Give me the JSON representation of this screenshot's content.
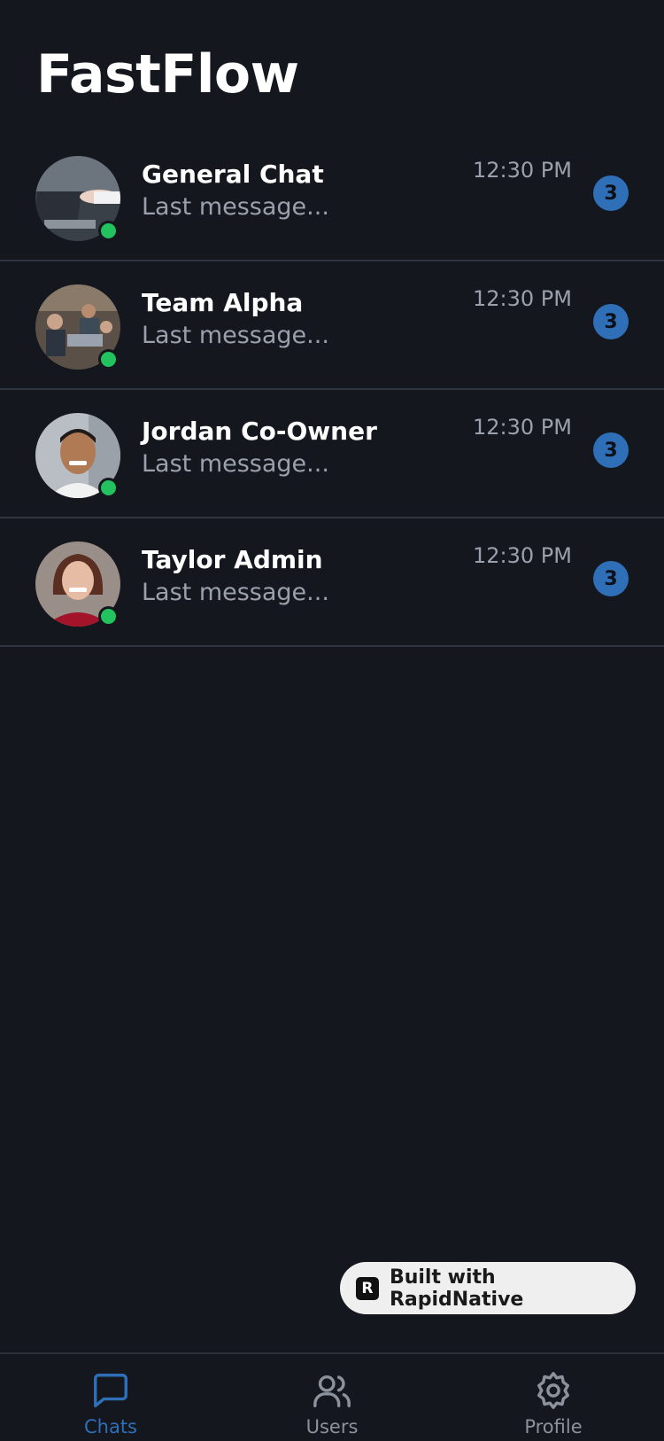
{
  "app": {
    "title": "FastFlow"
  },
  "chats": [
    {
      "name": "General Chat",
      "preview": "Last message...",
      "time": "12:30 PM",
      "unread": "3",
      "online": true
    },
    {
      "name": "Team Alpha",
      "preview": "Last message...",
      "time": "12:30 PM",
      "unread": "3",
      "online": true
    },
    {
      "name": "Jordan Co-Owner",
      "preview": "Last message...",
      "time": "12:30 PM",
      "unread": "3",
      "online": true
    },
    {
      "name": "Taylor Admin",
      "preview": "Last message...",
      "time": "12:30 PM",
      "unread": "3",
      "online": true
    }
  ],
  "badge": {
    "label": "Built with RapidNative",
    "logo": "R"
  },
  "tabs": [
    {
      "label": "Chats",
      "icon": "chat-bubble-icon",
      "active": true
    },
    {
      "label": "Users",
      "icon": "users-icon",
      "active": false
    },
    {
      "label": "Profile",
      "icon": "gear-icon",
      "active": false
    }
  ],
  "colors": {
    "background": "#14171d",
    "accent": "#2f6fb8",
    "online": "#22c35e",
    "muted_text": "#9aa1ac"
  }
}
